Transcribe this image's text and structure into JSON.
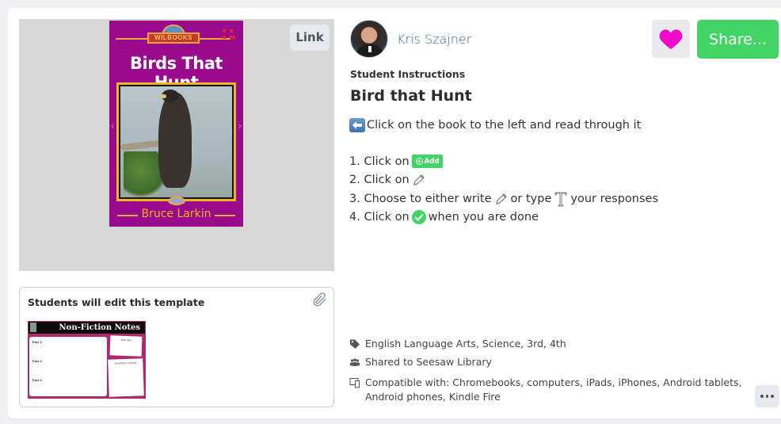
{
  "preview": {
    "book": {
      "publisher": "WILBOOKS",
      "title": "Birds That Hunt",
      "author": "Bruce Larkin"
    },
    "link_label": "Link"
  },
  "template": {
    "label": "Students will edit this template",
    "thumbnail": {
      "title": "Non-Fiction Notes",
      "facts": [
        "Fact 1:",
        "Fact 2:",
        "Fact 3:"
      ],
      "box_top": "Main Idea",
      "box_bottom": "Something I Learned"
    }
  },
  "author": {
    "name": "Kris Szajner"
  },
  "actions": {
    "like_icon": "heart-icon",
    "share_label": "Share...",
    "more_icon": "ellipsis-icon"
  },
  "colors": {
    "accent_green": "#43d466",
    "heart_magenta": "#f20acb",
    "link_blue": "#2f6fa8",
    "book_purple": "#990a8c"
  },
  "instructions": {
    "section_label": "Student Instructions",
    "title": "Bird that Hunt",
    "intro": "Click on the book to the left and read through it",
    "steps": [
      {
        "prefix": "1. Click on",
        "icon": "add-button-icon",
        "icon_label": "Add",
        "suffix": ""
      },
      {
        "prefix": "2. Click on",
        "icon": "pencil-icon",
        "suffix": ""
      },
      {
        "prefix": "3. Choose to either write",
        "icon": "pencil-icon",
        "middle": "or type",
        "icon2": "text-icon",
        "suffix": "your responses"
      },
      {
        "prefix": "4. Click on",
        "icon": "check-icon",
        "suffix": "when you are done"
      }
    ]
  },
  "meta": {
    "tags": "English Language Arts, Science, 3rd, 4th",
    "shared": "Shared to Seesaw Library",
    "compatible_line1": "Compatible with: Chromebooks, computers, iPads, iPhones, Android tablets,",
    "compatible_line2": "Android phones, Kindle Fire"
  }
}
